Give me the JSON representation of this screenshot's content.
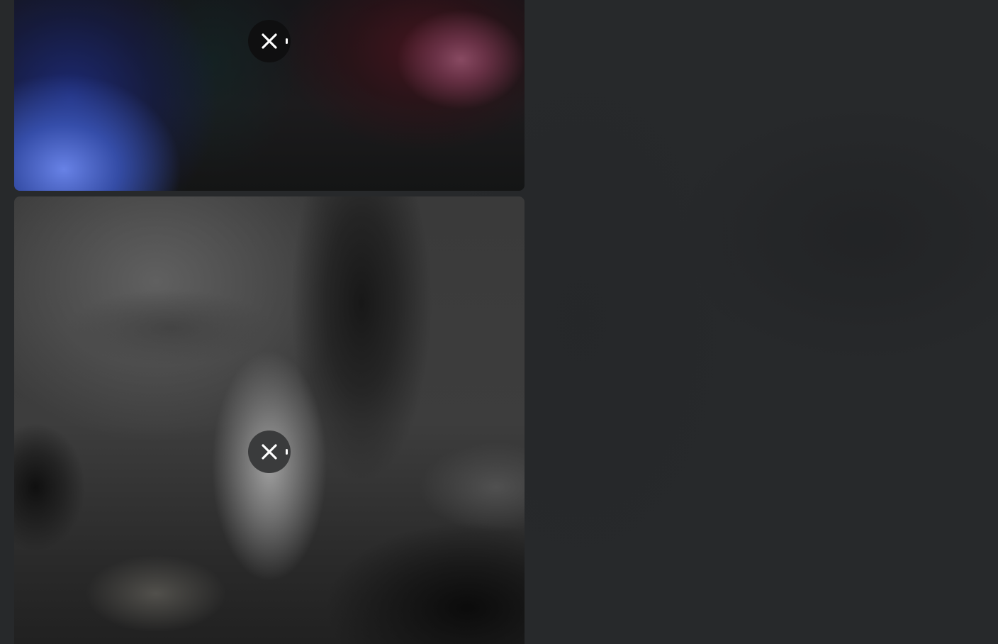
{
  "page": {
    "background_color": "#27292b"
  },
  "feed": {
    "cards": [
      {
        "media": "blurred-image",
        "close_button": {
          "icon": "close-icon",
          "background_color": "#0f0f10"
        }
      },
      {
        "media": "blurred-image",
        "close_button": {
          "icon": "close-icon",
          "background_color": "#3a3b3c"
        }
      }
    ]
  }
}
